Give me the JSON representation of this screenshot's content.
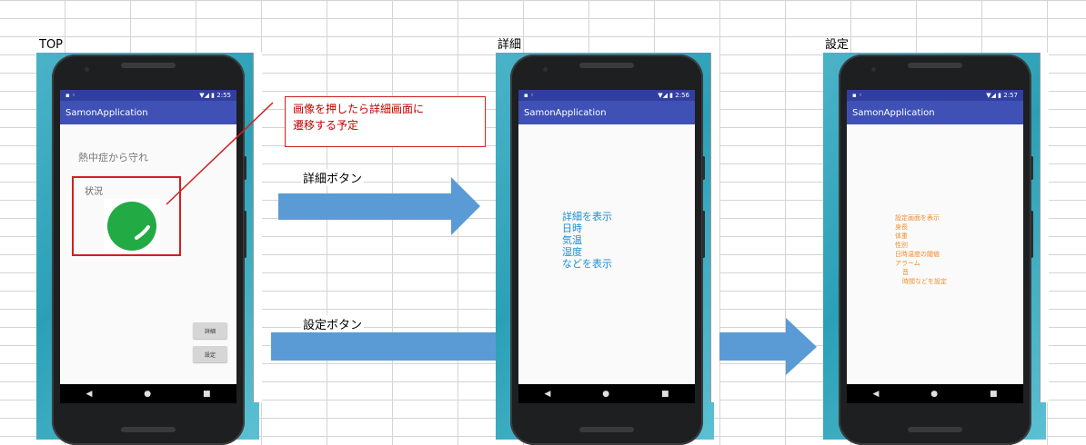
{
  "labels": {
    "top": "TOP",
    "detail": "詳細",
    "settings": "設定"
  },
  "app": {
    "title": "SamonApplication"
  },
  "screens": [
    {
      "time": "2:55"
    },
    {
      "time": "2:56"
    },
    {
      "time": "2:57"
    }
  ],
  "top_screen": {
    "heading": "熱中症から守れ",
    "status_label": "状況",
    "detail_button": "詳細",
    "settings_button": "設定"
  },
  "callout": {
    "line1": "画像を押したら詳細画面に",
    "line2": "遷移する予定"
  },
  "arrows": {
    "detail_note": "詳細ボタン",
    "settings_note": "設定ボタン"
  },
  "detail_screen": {
    "lines": [
      "詳細を表示",
      "日時",
      "気温",
      "湿度",
      "などを表示"
    ]
  },
  "settings_screen": {
    "lines": [
      "設定画面を表示",
      "身長",
      "体重",
      "性別",
      "日時温度の閾値",
      "アラーム",
      "音",
      "時間などを設定"
    ]
  },
  "nav": {
    "back": "◀",
    "home": "●",
    "recent": "■"
  },
  "colors": {
    "status_bar": "#303f9f",
    "app_bar": "#3f51b5",
    "arrow": "#5b9bd5",
    "callout_border": "#d21f1f",
    "status_circle": "#22aa44",
    "detail_text": "#1f8fd0",
    "settings_text": "#f08c2a"
  }
}
